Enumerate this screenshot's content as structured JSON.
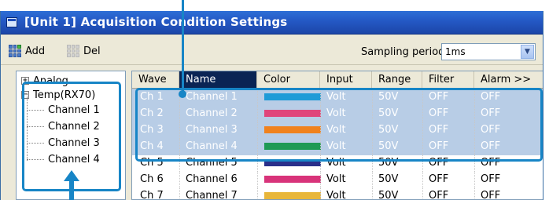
{
  "window": {
    "title": "[Unit 1] Acquisition Condition Settings"
  },
  "toolbar": {
    "add_label": "Add",
    "del_label": "Del",
    "sampling_label": "Sampling period",
    "sampling_value": "1ms"
  },
  "tree": {
    "root_label": "Analog",
    "group_label": "Temp(RX70)",
    "channels": [
      "Channel 1",
      "Channel 2",
      "Channel 3",
      "Channel 4"
    ]
  },
  "table": {
    "columns": [
      "Wave",
      "Name",
      "Color",
      "Input",
      "Range",
      "Filter",
      "Alarm >>"
    ],
    "rows": [
      {
        "wave": "Ch 1",
        "name": "Channel 1",
        "color": "#1e9bd7",
        "input": "Volt",
        "range": "50V",
        "filter": "OFF",
        "alarm": "OFF",
        "selected": true
      },
      {
        "wave": "Ch 2",
        "name": "Channel 2",
        "color": "#e0457b",
        "input": "Volt",
        "range": "50V",
        "filter": "OFF",
        "alarm": "OFF",
        "selected": true
      },
      {
        "wave": "Ch 3",
        "name": "Channel 3",
        "color": "#f0821e",
        "input": "Volt",
        "range": "50V",
        "filter": "OFF",
        "alarm": "OFF",
        "selected": true
      },
      {
        "wave": "Ch 4",
        "name": "Channel 4",
        "color": "#1e9a55",
        "input": "Volt",
        "range": "50V",
        "filter": "OFF",
        "alarm": "OFF",
        "selected": true
      },
      {
        "wave": "Ch 5",
        "name": "Channel 5",
        "color": "#2a2f8a",
        "input": "Volt",
        "range": "50V",
        "filter": "OFF",
        "alarm": "OFF",
        "selected": false
      },
      {
        "wave": "Ch 6",
        "name": "Channel 6",
        "color": "#d8337a",
        "input": "Volt",
        "range": "50V",
        "filter": "OFF",
        "alarm": "OFF",
        "selected": false
      },
      {
        "wave": "Ch 7",
        "name": "Channel 7",
        "color": "#e8b63a",
        "input": "Volt",
        "range": "50V",
        "filter": "OFF",
        "alarm": "OFF",
        "selected": false
      }
    ]
  },
  "colors": {
    "callout": "#1785c6",
    "selection": "#b8cde6",
    "header_selected": "#0a2454",
    "titlebar": "#2458c4"
  }
}
